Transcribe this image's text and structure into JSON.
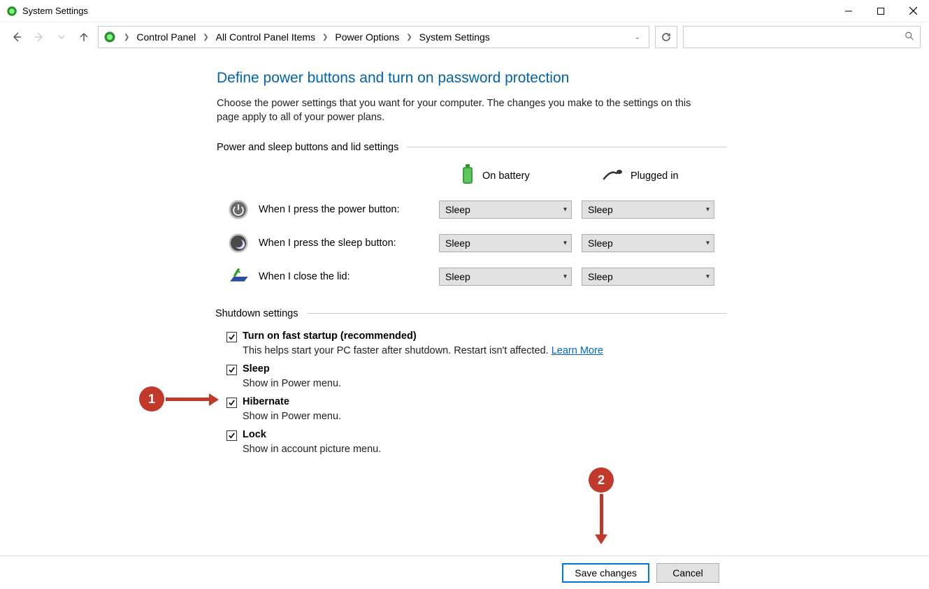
{
  "window": {
    "title": "System Settings"
  },
  "breadcrumb": {
    "items": [
      "Control Panel",
      "All Control Panel Items",
      "Power Options",
      "System Settings"
    ]
  },
  "page": {
    "title": "Define power buttons and turn on password protection",
    "description": "Choose the power settings that you want for your computer. The changes you make to the settings on this page apply to all of your power plans."
  },
  "sections": {
    "power_header": "Power and sleep buttons and lid settings",
    "col_battery": "On battery",
    "col_plugged": "Plugged in",
    "rows": [
      {
        "label": "When I press the power button:",
        "battery": "Sleep",
        "plugged": "Sleep"
      },
      {
        "label": "When I press the sleep button:",
        "battery": "Sleep",
        "plugged": "Sleep"
      },
      {
        "label": "When I close the lid:",
        "battery": "Sleep",
        "plugged": "Sleep"
      }
    ],
    "shutdown_header": "Shutdown settings",
    "options": [
      {
        "title": "Turn on fast startup (recommended)",
        "desc": "This helps start your PC faster after shutdown. Restart isn't affected. ",
        "link": "Learn More",
        "checked": true
      },
      {
        "title": "Sleep",
        "desc": "Show in Power menu.",
        "checked": true
      },
      {
        "title": "Hibernate",
        "desc": "Show in Power menu.",
        "checked": true
      },
      {
        "title": "Lock",
        "desc": "Show in account picture menu.",
        "checked": true
      }
    ]
  },
  "buttons": {
    "save": "Save changes",
    "cancel": "Cancel"
  },
  "annotations": {
    "one": "1",
    "two": "2"
  }
}
